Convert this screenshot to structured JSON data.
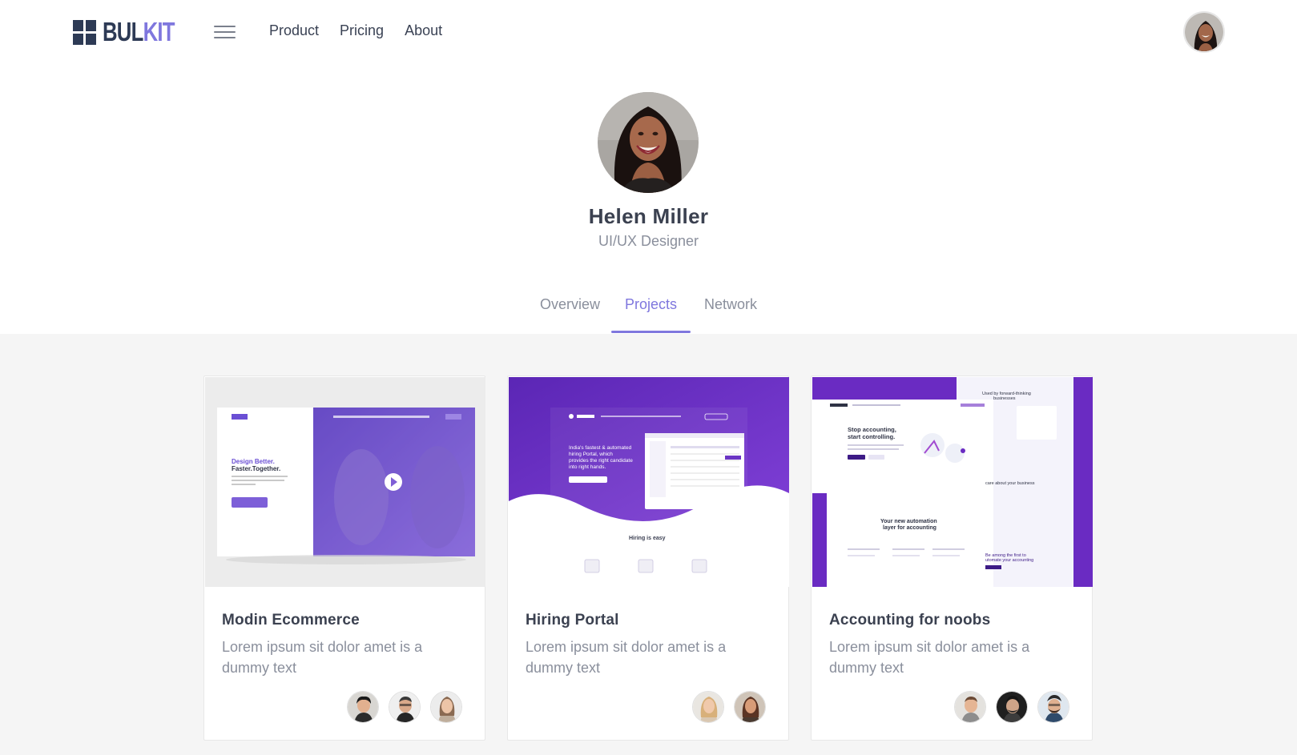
{
  "navbar": {
    "logo": {
      "bul": "BUL",
      "kit": "KIT"
    },
    "links": [
      "Product",
      "Pricing",
      "About"
    ]
  },
  "profile": {
    "name": "Helen Miller",
    "role": "UI/UX Designer"
  },
  "tabs": [
    {
      "label": "Overview",
      "active": false
    },
    {
      "label": "Projects",
      "active": true
    },
    {
      "label": "Network",
      "active": false
    }
  ],
  "projects": [
    {
      "title": "Modin Ecommerce",
      "description": "Lorem ipsum sit dolor amet is a dummy text",
      "preview": {
        "headline": "Design Better. Faster.Together."
      }
    },
    {
      "title": "Hiring Portal",
      "description": "Lorem ipsum sit dolor amet is a dummy text",
      "preview": {
        "headline": "Hiring is easy"
      }
    },
    {
      "title": "Accounting for noobs",
      "description": "Lorem ipsum sit dolor amet is a dummy text",
      "preview": {
        "headline": "Stop accounting, start controlling."
      }
    }
  ],
  "colors": {
    "accent": "#7f77de",
    "heading": "#3b4150",
    "muted": "#8a8f9c",
    "section_bg": "#f5f5f5"
  }
}
